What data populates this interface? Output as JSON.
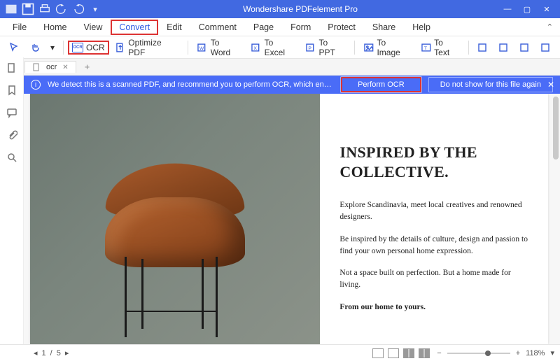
{
  "titlebar": {
    "app_title": "Wondershare PDFelement Pro"
  },
  "menu": {
    "items": [
      "File",
      "Home",
      "View",
      "Convert",
      "Edit",
      "Comment",
      "Page",
      "Form",
      "Protect",
      "Share",
      "Help"
    ],
    "active_index": 3
  },
  "toolbar": {
    "ocr": "OCR",
    "optimize": "Optimize PDF",
    "to_word": "To Word",
    "to_excel": "To Excel",
    "to_ppt": "To PPT",
    "to_image": "To Image",
    "to_text": "To Text"
  },
  "tabs": {
    "items": [
      {
        "label": "ocr"
      }
    ]
  },
  "notice": {
    "message": "We detect this is a scanned PDF, and recommend you to perform OCR, which enables you to ...",
    "perform": "Perform OCR",
    "dismiss": "Do not show for this file again"
  },
  "document": {
    "heading": "INSPIRED BY THE COLLECTIVE.",
    "p1": "Explore Scandinavia, meet local creatives and renowned designers.",
    "p2": "Be inspired by the details of culture, design and passion to find your own personal home expression.",
    "p3": "Not a space built on perfection. But a home made for living.",
    "p4": "From our home to yours."
  },
  "status": {
    "page_current": "1",
    "page_sep": "/",
    "page_total": "5",
    "zoom": "118%"
  }
}
